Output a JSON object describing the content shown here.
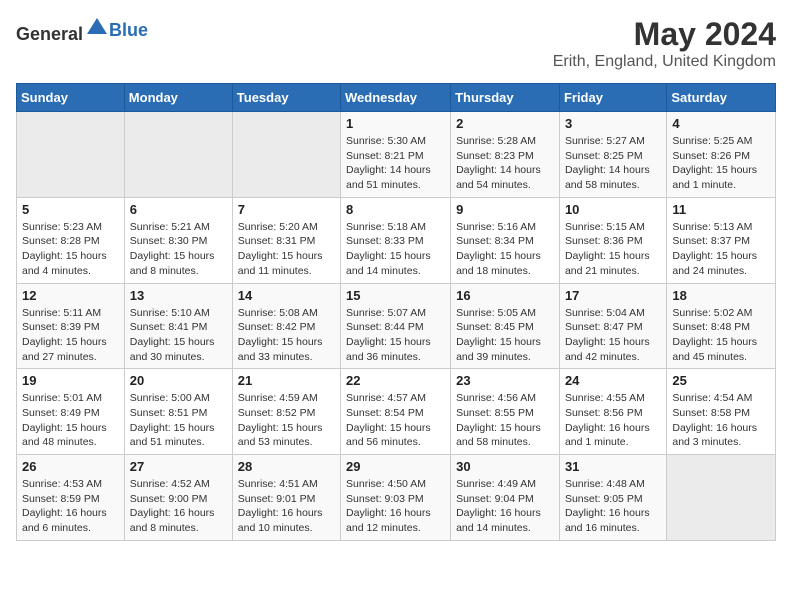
{
  "header": {
    "logo_general": "General",
    "logo_blue": "Blue",
    "title": "May 2024",
    "subtitle": "Erith, England, United Kingdom"
  },
  "days_of_week": [
    "Sunday",
    "Monday",
    "Tuesday",
    "Wednesday",
    "Thursday",
    "Friday",
    "Saturday"
  ],
  "weeks": [
    [
      {
        "day": "",
        "empty": true
      },
      {
        "day": "",
        "empty": true
      },
      {
        "day": "",
        "empty": true
      },
      {
        "day": "1",
        "sunrise": "5:30 AM",
        "sunset": "8:21 PM",
        "daylight": "14 hours and 51 minutes."
      },
      {
        "day": "2",
        "sunrise": "5:28 AM",
        "sunset": "8:23 PM",
        "daylight": "14 hours and 54 minutes."
      },
      {
        "day": "3",
        "sunrise": "5:27 AM",
        "sunset": "8:25 PM",
        "daylight": "14 hours and 58 minutes."
      },
      {
        "day": "4",
        "sunrise": "5:25 AM",
        "sunset": "8:26 PM",
        "daylight": "15 hours and 1 minute."
      }
    ],
    [
      {
        "day": "5",
        "sunrise": "5:23 AM",
        "sunset": "8:28 PM",
        "daylight": "15 hours and 4 minutes."
      },
      {
        "day": "6",
        "sunrise": "5:21 AM",
        "sunset": "8:30 PM",
        "daylight": "15 hours and 8 minutes."
      },
      {
        "day": "7",
        "sunrise": "5:20 AM",
        "sunset": "8:31 PM",
        "daylight": "15 hours and 11 minutes."
      },
      {
        "day": "8",
        "sunrise": "5:18 AM",
        "sunset": "8:33 PM",
        "daylight": "15 hours and 14 minutes."
      },
      {
        "day": "9",
        "sunrise": "5:16 AM",
        "sunset": "8:34 PM",
        "daylight": "15 hours and 18 minutes."
      },
      {
        "day": "10",
        "sunrise": "5:15 AM",
        "sunset": "8:36 PM",
        "daylight": "15 hours and 21 minutes."
      },
      {
        "day": "11",
        "sunrise": "5:13 AM",
        "sunset": "8:37 PM",
        "daylight": "15 hours and 24 minutes."
      }
    ],
    [
      {
        "day": "12",
        "sunrise": "5:11 AM",
        "sunset": "8:39 PM",
        "daylight": "15 hours and 27 minutes."
      },
      {
        "day": "13",
        "sunrise": "5:10 AM",
        "sunset": "8:41 PM",
        "daylight": "15 hours and 30 minutes."
      },
      {
        "day": "14",
        "sunrise": "5:08 AM",
        "sunset": "8:42 PM",
        "daylight": "15 hours and 33 minutes."
      },
      {
        "day": "15",
        "sunrise": "5:07 AM",
        "sunset": "8:44 PM",
        "daylight": "15 hours and 36 minutes."
      },
      {
        "day": "16",
        "sunrise": "5:05 AM",
        "sunset": "8:45 PM",
        "daylight": "15 hours and 39 minutes."
      },
      {
        "day": "17",
        "sunrise": "5:04 AM",
        "sunset": "8:47 PM",
        "daylight": "15 hours and 42 minutes."
      },
      {
        "day": "18",
        "sunrise": "5:02 AM",
        "sunset": "8:48 PM",
        "daylight": "15 hours and 45 minutes."
      }
    ],
    [
      {
        "day": "19",
        "sunrise": "5:01 AM",
        "sunset": "8:49 PM",
        "daylight": "15 hours and 48 minutes."
      },
      {
        "day": "20",
        "sunrise": "5:00 AM",
        "sunset": "8:51 PM",
        "daylight": "15 hours and 51 minutes."
      },
      {
        "day": "21",
        "sunrise": "4:59 AM",
        "sunset": "8:52 PM",
        "daylight": "15 hours and 53 minutes."
      },
      {
        "day": "22",
        "sunrise": "4:57 AM",
        "sunset": "8:54 PM",
        "daylight": "15 hours and 56 minutes."
      },
      {
        "day": "23",
        "sunrise": "4:56 AM",
        "sunset": "8:55 PM",
        "daylight": "15 hours and 58 minutes."
      },
      {
        "day": "24",
        "sunrise": "4:55 AM",
        "sunset": "8:56 PM",
        "daylight": "16 hours and 1 minute."
      },
      {
        "day": "25",
        "sunrise": "4:54 AM",
        "sunset": "8:58 PM",
        "daylight": "16 hours and 3 minutes."
      }
    ],
    [
      {
        "day": "26",
        "sunrise": "4:53 AM",
        "sunset": "8:59 PM",
        "daylight": "16 hours and 6 minutes."
      },
      {
        "day": "27",
        "sunrise": "4:52 AM",
        "sunset": "9:00 PM",
        "daylight": "16 hours and 8 minutes."
      },
      {
        "day": "28",
        "sunrise": "4:51 AM",
        "sunset": "9:01 PM",
        "daylight": "16 hours and 10 minutes."
      },
      {
        "day": "29",
        "sunrise": "4:50 AM",
        "sunset": "9:03 PM",
        "daylight": "16 hours and 12 minutes."
      },
      {
        "day": "30",
        "sunrise": "4:49 AM",
        "sunset": "9:04 PM",
        "daylight": "16 hours and 14 minutes."
      },
      {
        "day": "31",
        "sunrise": "4:48 AM",
        "sunset": "9:05 PM",
        "daylight": "16 hours and 16 minutes."
      },
      {
        "day": "",
        "empty": true
      }
    ]
  ],
  "labels": {
    "sunrise_prefix": "Sunrise: ",
    "sunset_prefix": "Sunset: ",
    "daylight_prefix": "Daylight: "
  }
}
